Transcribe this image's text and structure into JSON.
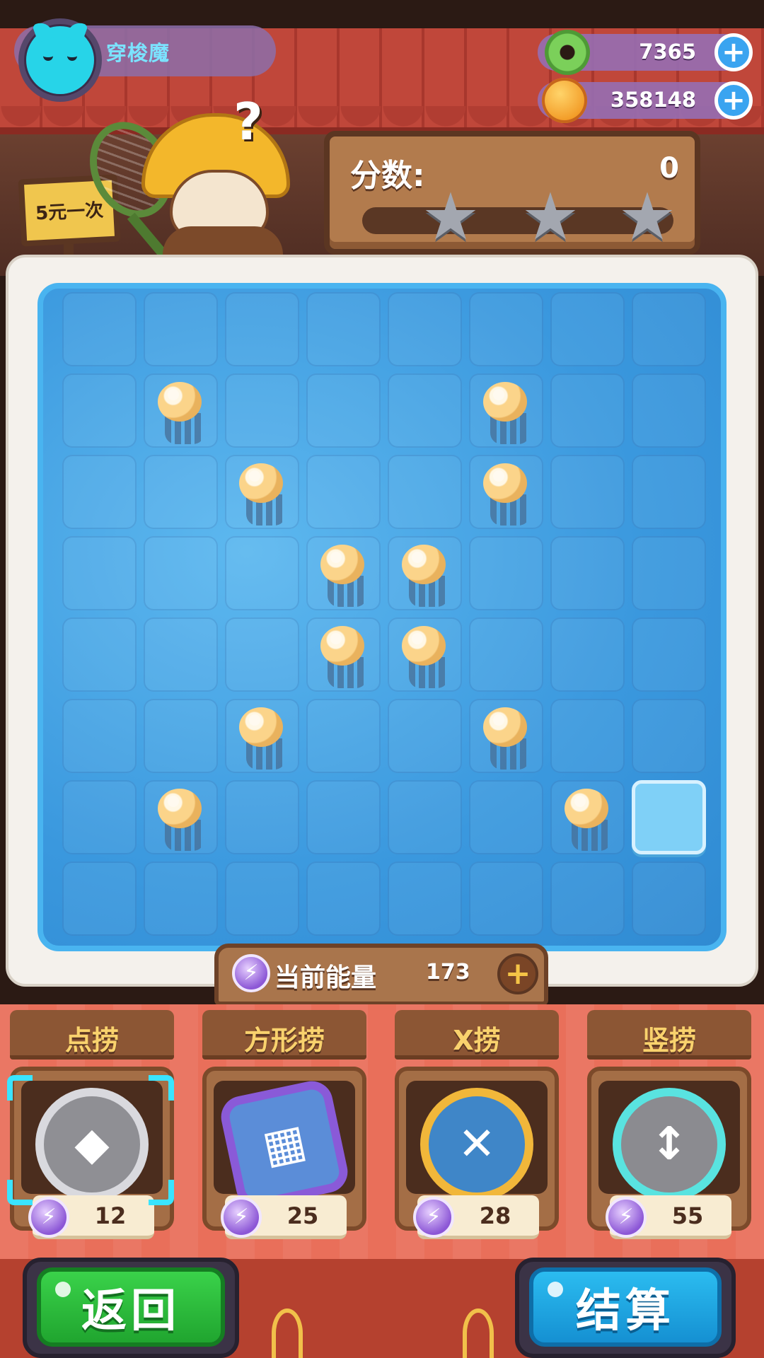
{
  "player": {
    "name": "穿梭魔",
    "avatar": "cat-avatar-icon"
  },
  "currencies": [
    {
      "icon": "donut-icon",
      "value": "7365"
    },
    {
      "icon": "planet-coin-icon",
      "value": "358148"
    }
  ],
  "shop_sign": "5元一次",
  "score": {
    "label": "分数:",
    "value": "0",
    "stars_total": 3,
    "stars_earned": 0
  },
  "board": {
    "rows": 8,
    "cols": 8,
    "jellyfish": [
      [
        1,
        1
      ],
      [
        1,
        5
      ],
      [
        2,
        2
      ],
      [
        2,
        5
      ],
      [
        3,
        3
      ],
      [
        3,
        4
      ],
      [
        4,
        3
      ],
      [
        4,
        4
      ],
      [
        5,
        2
      ],
      [
        5,
        5
      ],
      [
        6,
        1
      ],
      [
        6,
        6
      ]
    ],
    "selected_cell": [
      6,
      7
    ]
  },
  "energy": {
    "label": "当前能量",
    "value": "173"
  },
  "tools": [
    {
      "title": "点捞",
      "cost": "12",
      "icon": "dot-net-icon",
      "selected": true
    },
    {
      "title": "方形捞",
      "cost": "25",
      "icon": "square-net-icon",
      "selected": false
    },
    {
      "title": "X捞",
      "cost": "28",
      "icon": "x-net-icon",
      "selected": false
    },
    {
      "title": "竖捞",
      "cost": "55",
      "icon": "vertical-net-icon",
      "selected": false
    }
  ],
  "buttons": {
    "back": "返回",
    "settle": "结算"
  },
  "colors": {
    "back_button": "#2fbf3f",
    "settle_button": "#1fa6e3",
    "pool": "#3a98de",
    "selected_cell": "#7fd0f7"
  }
}
